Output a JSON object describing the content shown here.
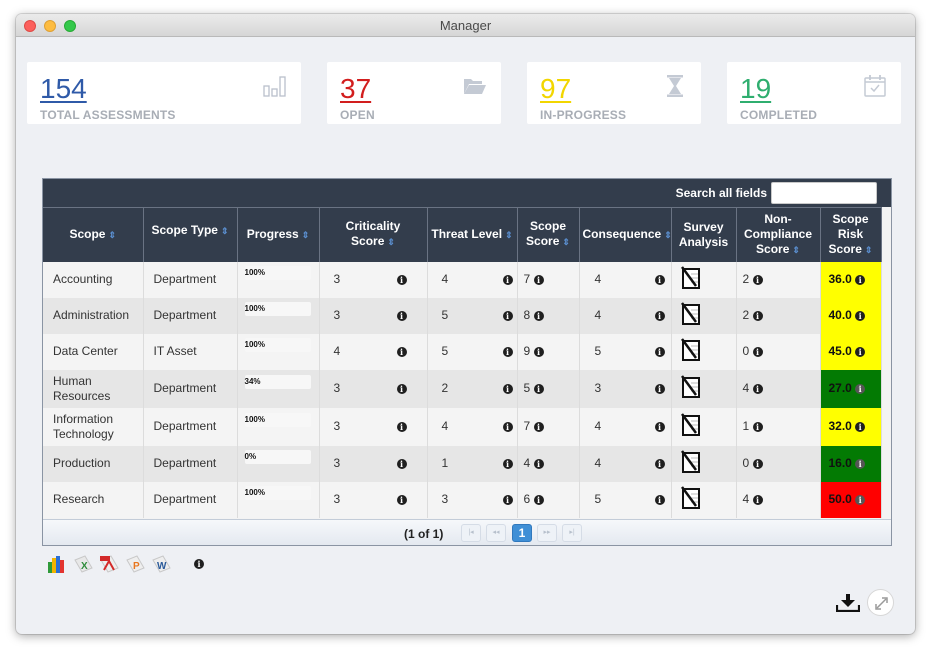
{
  "window": {
    "title": "Manager"
  },
  "stats": [
    {
      "value": "154",
      "label": "TOTAL ASSESSMENTS",
      "color": "#2f5aa8",
      "icon": "bar-chart-icon"
    },
    {
      "value": "37",
      "label": "OPEN",
      "color": "#d21e1e",
      "icon": "folder-open-icon"
    },
    {
      "value": "97",
      "label": "IN-PROGRESS",
      "color": "#f2d600",
      "icon": "hourglass-icon"
    },
    {
      "value": "19",
      "label": "COMPLETED",
      "color": "#2fae6f",
      "icon": "calendar-check-icon"
    }
  ],
  "table": {
    "search_label": "Search all fields",
    "search_value": "",
    "columns": [
      "Scope",
      "Scope Type",
      "Progress",
      "Criticality Score",
      "Threat Level",
      "Scope Score",
      "Consequence",
      "Survey Analysis",
      "Non-Compliance Score",
      "Scope Risk Score"
    ],
    "rows": [
      {
        "scope": "Accounting",
        "type": "Department",
        "progress": "100%",
        "progress_value": 100,
        "criticality": "3",
        "threat": "4",
        "scope_score": "7",
        "consequence": "4",
        "non_compliance": "2",
        "risk": "36.0",
        "risk_color": "#ffff00"
      },
      {
        "scope": "Administration",
        "type": "Department",
        "progress": "100%",
        "progress_value": 100,
        "criticality": "3",
        "threat": "5",
        "scope_score": "8",
        "consequence": "4",
        "non_compliance": "2",
        "risk": "40.0",
        "risk_color": "#ffff00"
      },
      {
        "scope": "Data Center",
        "type": "IT Asset",
        "progress": "100%",
        "progress_value": 100,
        "criticality": "4",
        "threat": "5",
        "scope_score": "9",
        "consequence": "5",
        "non_compliance": "0",
        "risk": "45.0",
        "risk_color": "#ffff00"
      },
      {
        "scope": "Human Resources",
        "type": "Department",
        "progress": "34%",
        "progress_value": 34,
        "criticality": "3",
        "threat": "2",
        "scope_score": "5",
        "consequence": "3",
        "non_compliance": "4",
        "risk": "27.0",
        "risk_color": "#037a03"
      },
      {
        "scope": "Information Technology",
        "type": "Department",
        "progress": "100%",
        "progress_value": 100,
        "criticality": "3",
        "threat": "4",
        "scope_score": "7",
        "consequence": "4",
        "non_compliance": "1",
        "risk": "32.0",
        "risk_color": "#ffff00"
      },
      {
        "scope": "Production",
        "type": "Department",
        "progress": "0%",
        "progress_value": 0,
        "criticality": "3",
        "threat": "1",
        "scope_score": "4",
        "consequence": "4",
        "non_compliance": "0",
        "risk": "16.0",
        "risk_color": "#037a03"
      },
      {
        "scope": "Research",
        "type": "Department",
        "progress": "100%",
        "progress_value": 100,
        "criticality": "3",
        "threat": "3",
        "scope_score": "6",
        "consequence": "5",
        "non_compliance": "4",
        "risk": "50.0",
        "risk_color": "#ff0000"
      }
    ]
  },
  "pagination": {
    "text": "(1 of 1)",
    "current_page": "1",
    "first": "|◂",
    "prev": "◂◂",
    "next": "▸▸",
    "last": "▸|"
  },
  "exports": [
    "chart-export-icon",
    "excel-export-icon",
    "pdf-export-icon",
    "powerpoint-export-icon",
    "word-export-icon"
  ],
  "info_glyph": "i"
}
